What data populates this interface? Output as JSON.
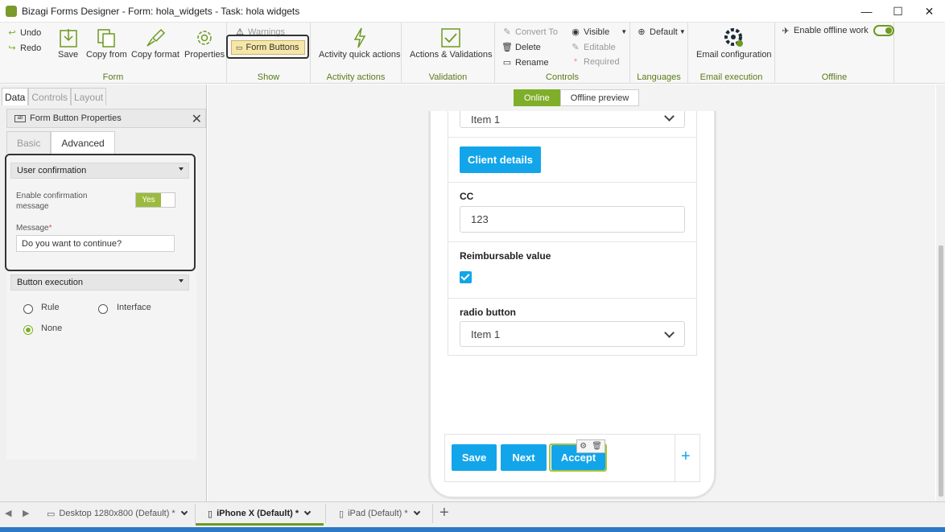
{
  "window": {
    "title": "Bizagi Forms Designer - Form: hola_widgets - Task:  hola widgets",
    "minimize": "—",
    "maximize": "☐",
    "close": "✕"
  },
  "ribbon": {
    "form_group": {
      "label": "Form",
      "undo": "Undo",
      "redo": "Redo",
      "save": "Save",
      "copy_from": "Copy from",
      "copy_format": "Copy format",
      "properties": "Properties"
    },
    "show_group": {
      "label": "Show",
      "warnings": "Warnings",
      "form_buttons": "Form Buttons"
    },
    "activity_group": {
      "label": "Activity actions",
      "quick_actions": "Activity quick actions"
    },
    "validation_group": {
      "label": "Validation",
      "actions_validations": "Actions & Validations"
    },
    "controls_group": {
      "label": "Controls",
      "convert_to": "Convert To",
      "delete": "Delete",
      "rename": "Rename",
      "visible": "Visible",
      "editable": "Editable",
      "required": "Required"
    },
    "languages_group": {
      "label": "Languages",
      "default": "Default"
    },
    "email_group": {
      "label": "Email execution",
      "email_configuration": "Email configuration"
    },
    "offline_group": {
      "label": "Offline",
      "enable_offline": "Enable offline work"
    }
  },
  "left_panel": {
    "tabs": [
      "Data",
      "Controls",
      "Layout"
    ],
    "properties_title": "Form Button Properties",
    "sub_tabs": [
      "Basic",
      "Advanced"
    ],
    "user_confirmation": {
      "header": "User confirmation",
      "enable_label_line1": "Enable confirmation",
      "enable_label_line2": "message",
      "toggle_value": "Yes",
      "message_label": "Message",
      "required_mark": "*",
      "message_value": "Do you want to continue?"
    },
    "button_execution": {
      "header": "Button execution",
      "options": [
        "Rule",
        "Interface",
        "None"
      ],
      "selected": "None"
    }
  },
  "canvas": {
    "view_toggle": [
      "Online",
      "Offline preview"
    ],
    "form": {
      "top_select_value": "Item 1",
      "client_details_button": "Client details",
      "cc_label": "CC",
      "cc_value": "123",
      "reimbursable_label": "Reimbursable value",
      "reimbursable_checked": true,
      "radio_label": "radio button",
      "radio_select_value": "Item 1"
    },
    "form_buttons": [
      "Save",
      "Next",
      "Accept"
    ],
    "add_button": "+"
  },
  "device_tabs": {
    "items": [
      {
        "label": "Desktop 1280x800 (Default) *"
      },
      {
        "label": "iPhone X (Default) *"
      },
      {
        "label": "iPad (Default) *"
      }
    ],
    "active": "iPhone X (Default) *",
    "add": "+"
  },
  "colors": {
    "accent_green": "#7fae2a",
    "button_blue": "#12a5ea",
    "ribbon_label_green": "#5a7a1a"
  }
}
